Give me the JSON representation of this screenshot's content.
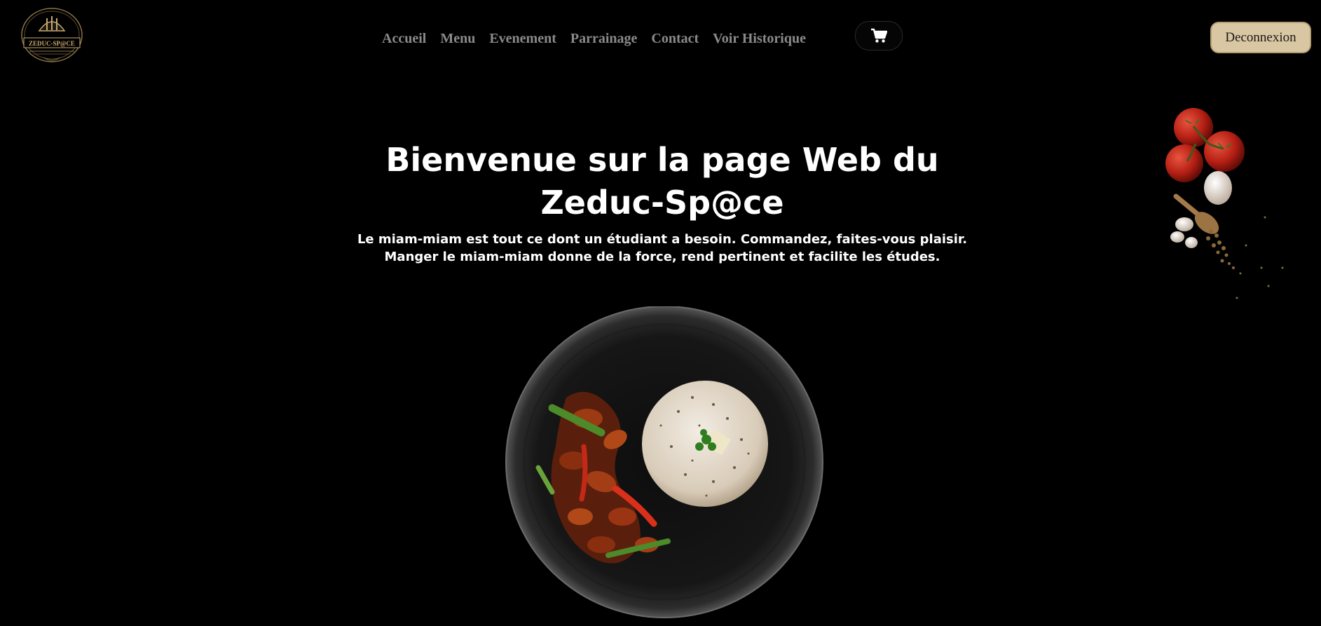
{
  "header": {
    "logo_text": "ZEDUC-SP@CE",
    "nav": [
      {
        "label": "Accueil"
      },
      {
        "label": "Menu"
      },
      {
        "label": "Evenement"
      },
      {
        "label": "Parrainage"
      },
      {
        "label": "Contact"
      },
      {
        "label": "Voir Historique"
      }
    ],
    "cart_icon": "shopping-cart-icon",
    "logout_label": "Deconnexion"
  },
  "hero": {
    "title": "Bienvenue sur la page Web du Zeduc-Sp@ce",
    "subtitle_line1": "Le miam-miam est tout ce dont un étudiant a besoin. Commandez, faites-vous plaisir.",
    "subtitle_line2": "Manger le miam-miam donne de la force, rend pertinent et facilite les études."
  },
  "colors": {
    "background": "#000000",
    "nav_text": "#8a8a8a",
    "logout_bg": "#d9c6a2",
    "logo_gold": "#c9a96e"
  }
}
